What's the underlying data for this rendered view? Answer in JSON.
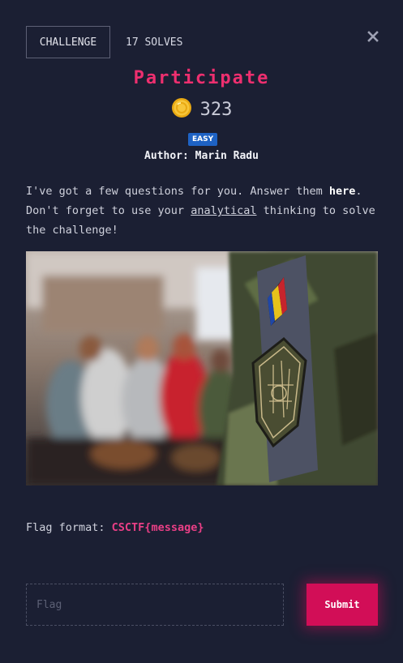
{
  "tabs": {
    "challenge_label": "CHALLENGE",
    "solves_label": "17 SOLVES"
  },
  "challenge": {
    "title": "Participate",
    "points": "323",
    "difficulty": "EASY",
    "author": "Author: Marin Radu"
  },
  "description": {
    "line1_a": "I've got a few questions for you. Answer them ",
    "link_here": "here",
    "line1_b": ". Don't forget to use your ",
    "underlined": "analytical",
    "line1_c": " thinking to solve the challenge!"
  },
  "flag_format": {
    "label": "Flag format: ",
    "code": "CSCTF{message}"
  },
  "form": {
    "placeholder": "Flag",
    "submit_label": "Submit"
  },
  "colors": {
    "accent": "#ee2f6f",
    "submit": "#d20e57",
    "badge": "#1e62c4",
    "background": "#1b1f33"
  },
  "icons": {
    "close": "close-icon",
    "coin": "coin-icon"
  }
}
